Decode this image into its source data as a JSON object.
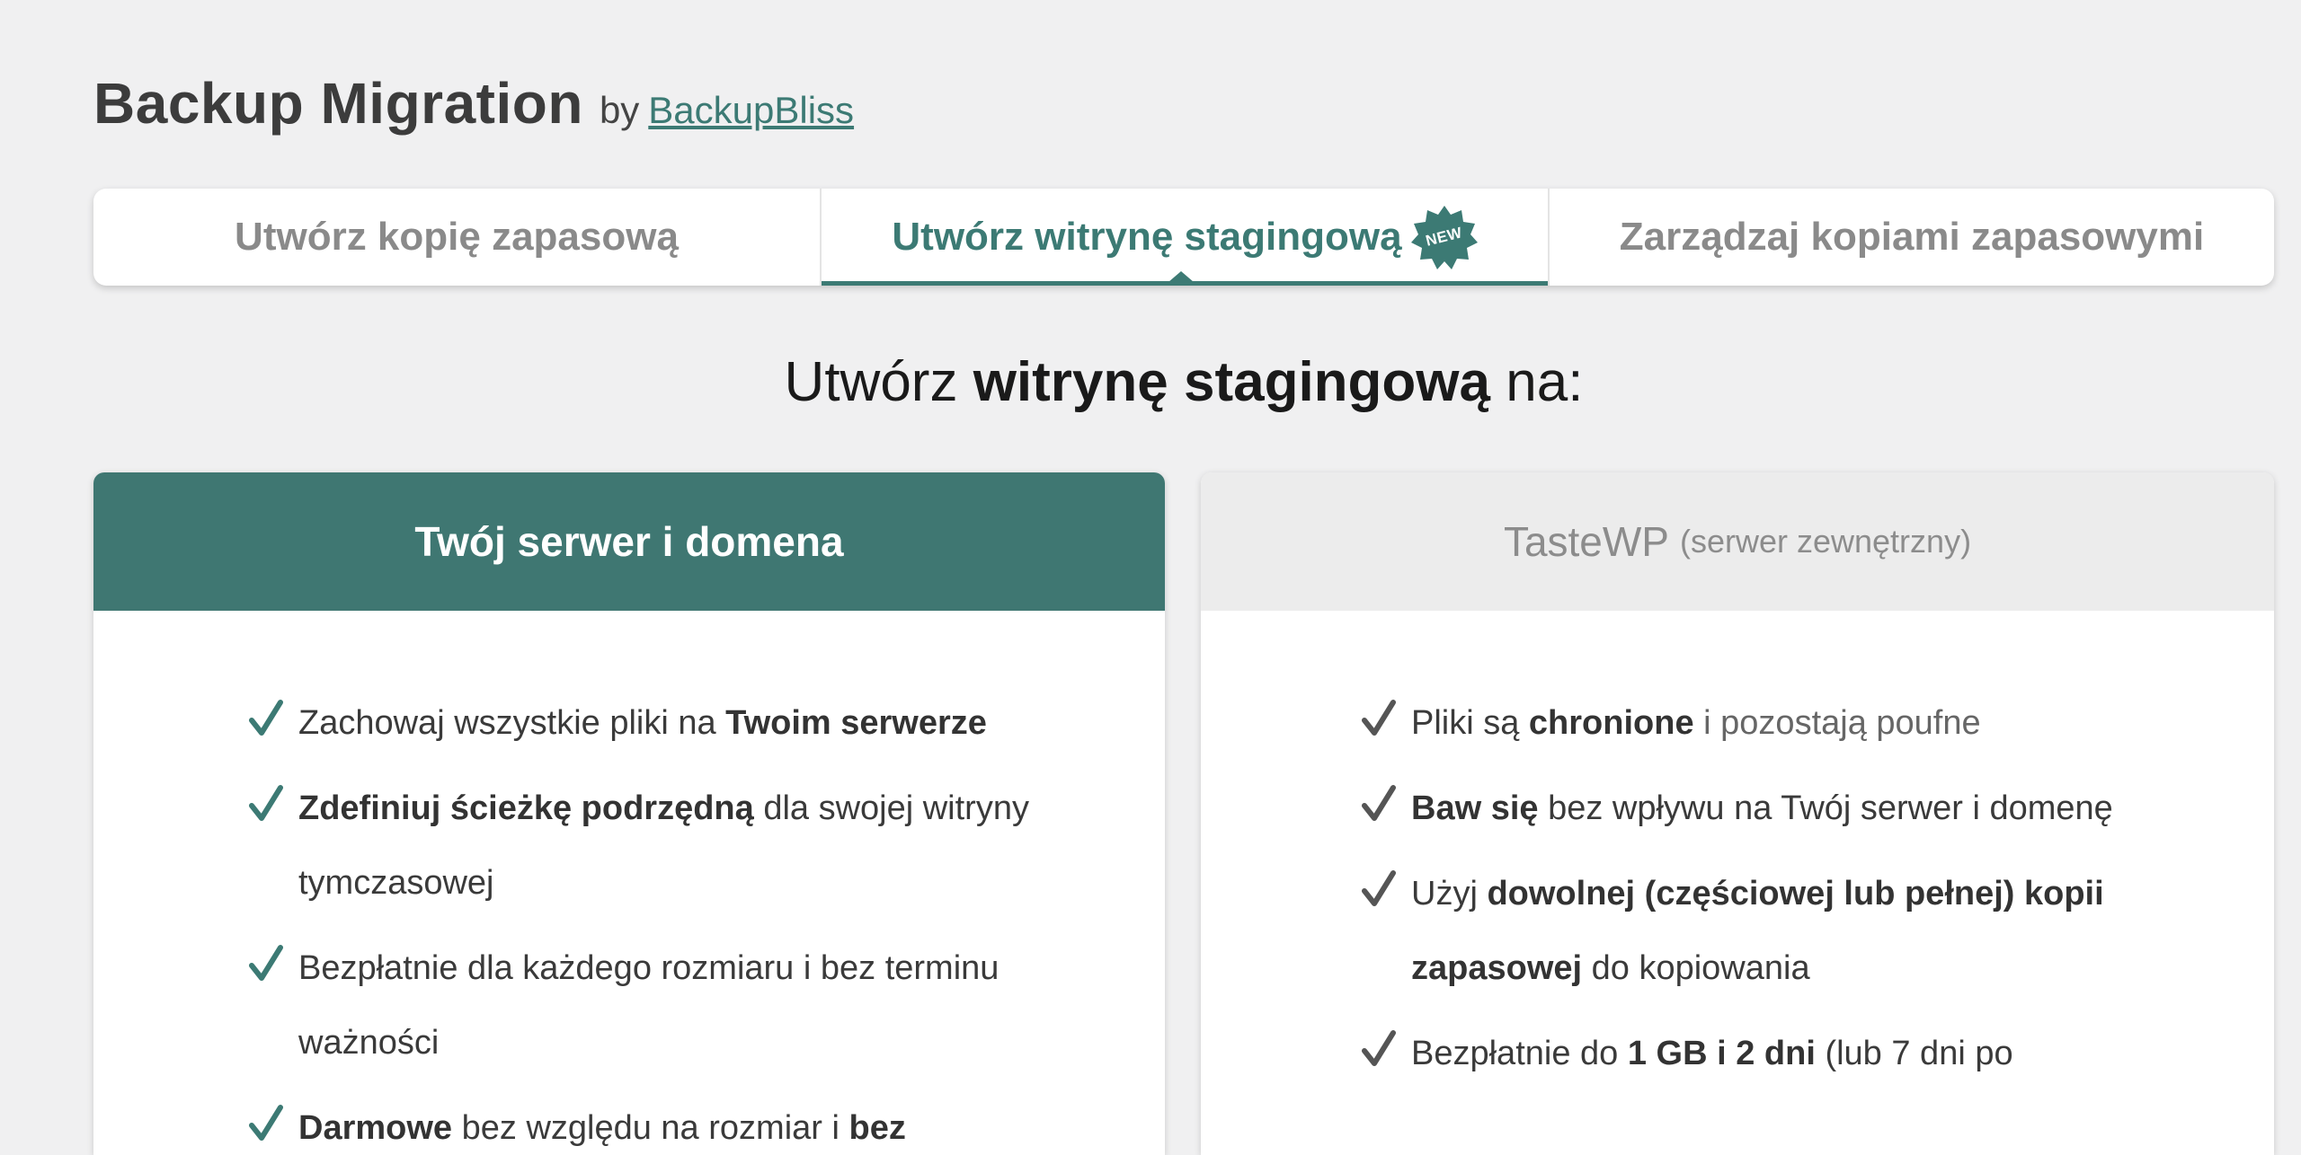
{
  "header": {
    "title": "Backup Migration",
    "by": "by",
    "brand": "BackupBliss"
  },
  "tabs": [
    {
      "label": "Utwórz kopię zapasową"
    },
    {
      "label": "Utwórz witrynę stagingową",
      "badge": "NEW",
      "active": true
    },
    {
      "label": "Zarządzaj kopiami zapasowymi"
    }
  ],
  "heading": {
    "pre": "Utwórz",
    "bold": "witrynę stagingową",
    "post": "na:"
  },
  "cards": {
    "left": {
      "title": "Twój serwer i domena",
      "features": [
        {
          "a": "Zachowaj wszystkie pliki na ",
          "b": "Twoim serwerze",
          "c": ""
        },
        {
          "a": "",
          "b": "Zdefiniuj ścieżkę podrzędną",
          "c": " dla swojej witryny tymczasowej"
        },
        {
          "a": "Bezpłatnie dla każdego rozmiaru i bez terminu ważności",
          "b": "",
          "c": ""
        },
        {
          "a": "",
          "b": "Darmowe",
          "c": " bez względu na rozmiar i ",
          "d": "bez"
        }
      ]
    },
    "right": {
      "title": "TasteWP",
      "subtitle": "(serwer zewnętrzny)",
      "features": [
        {
          "a": "Pliki są ",
          "b": "chronione",
          "c": " i pozostają poufne"
        },
        {
          "a": "",
          "b": "Baw się",
          "c": " bez wpływu na Twój serwer i domenę"
        },
        {
          "a": "Użyj ",
          "b": "dowolnej (częściowej lub pełnej) kopii zapasowej",
          "c": " do kopiowania"
        },
        {
          "a": "Bezpłatnie do ",
          "b": "1 GB i 2 dni",
          "c": " (lub 7 dni po"
        }
      ]
    }
  },
  "colors": {
    "accent": "#3c7a74",
    "card_header_active": "#3f7772",
    "background": "#f0f0f1"
  },
  "icons": [
    "check-icon",
    "new-badge-icon"
  ]
}
